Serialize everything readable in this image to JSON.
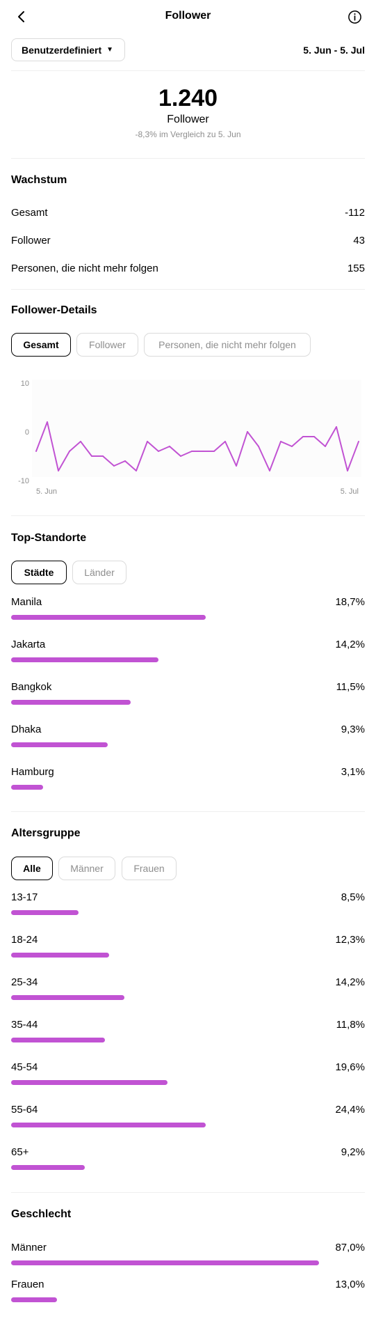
{
  "header": {
    "title": "Follower"
  },
  "filter": {
    "range_label": "Benutzerdefiniert",
    "date_range": "5. Jun - 5. Jul"
  },
  "summary": {
    "count": "1.240",
    "label": "Follower",
    "comparison": "-8,3% im Vergleich zu 5. Jun"
  },
  "growth": {
    "title": "Wachstum",
    "rows": [
      {
        "label": "Gesamt",
        "value": "-112"
      },
      {
        "label": "Follower",
        "value": "43"
      },
      {
        "label": "Personen, die nicht mehr folgen",
        "value": "155"
      }
    ]
  },
  "details": {
    "title": "Follower-Details",
    "tabs": [
      "Gesamt",
      "Follower",
      "Personen, die nicht mehr folgen"
    ],
    "active_tab": "Gesamt"
  },
  "chart_data": {
    "type": "line",
    "title": "",
    "xlabel": "",
    "ylabel": "",
    "x_tick_labels": [
      "5. Jun",
      "5. Jul"
    ],
    "y_tick_labels": [
      "10",
      "0",
      "-10"
    ],
    "ylim": [
      -10,
      10
    ],
    "grid": false,
    "color": "#c153d3",
    "values": [
      -4,
      2,
      -8,
      -4,
      -2,
      -5,
      -5,
      -7,
      -6,
      -8,
      -2,
      -4,
      -3,
      -5,
      -4,
      -4,
      -4,
      -2,
      -7,
      0,
      -3,
      -8,
      -2,
      -3,
      -1,
      -1,
      -3,
      1,
      -8,
      -2
    ]
  },
  "locations": {
    "title": "Top-Standorte",
    "tabs": [
      "Städte",
      "Länder"
    ],
    "active_tab": "Städte",
    "items": [
      {
        "label": "Manila",
        "value": "18,7%",
        "fraction": 0.187
      },
      {
        "label": "Jakarta",
        "value": "14,2%",
        "fraction": 0.142
      },
      {
        "label": "Bangkok",
        "value": "11,5%",
        "fraction": 0.115
      },
      {
        "label": "Dhaka",
        "value": "9,3%",
        "fraction": 0.093
      },
      {
        "label": "Hamburg",
        "value": "3,1%",
        "fraction": 0.031
      }
    ]
  },
  "age": {
    "title": "Altersgruppe",
    "tabs": [
      "Alle",
      "Männer",
      "Frauen"
    ],
    "active_tab": "Alle",
    "items": [
      {
        "label": "13-17",
        "value": "8,5%",
        "fraction": 0.085
      },
      {
        "label": "18-24",
        "value": "12,3%",
        "fraction": 0.123
      },
      {
        "label": "25-34",
        "value": "14,2%",
        "fraction": 0.142
      },
      {
        "label": "35-44",
        "value": "11,8%",
        "fraction": 0.118
      },
      {
        "label": "45-54",
        "value": "19,6%",
        "fraction": 0.196
      },
      {
        "label": "55-64",
        "value": "24,4%",
        "fraction": 0.244
      },
      {
        "label": "65+",
        "value": "9,2%",
        "fraction": 0.092
      }
    ]
  },
  "gender": {
    "title": "Geschlecht",
    "items": [
      {
        "label": "Männer",
        "value": "87,0%",
        "fraction": 0.87
      },
      {
        "label": "Frauen",
        "value": "13,0%",
        "fraction": 0.13
      }
    ]
  },
  "colors": {
    "accent": "#c153d3",
    "muted_text": "#8e8e8e",
    "divider": "#efefef"
  },
  "icons": {
    "back": "chevron-left-icon",
    "info": "info-circle-icon",
    "caret": "caret-down-icon"
  }
}
